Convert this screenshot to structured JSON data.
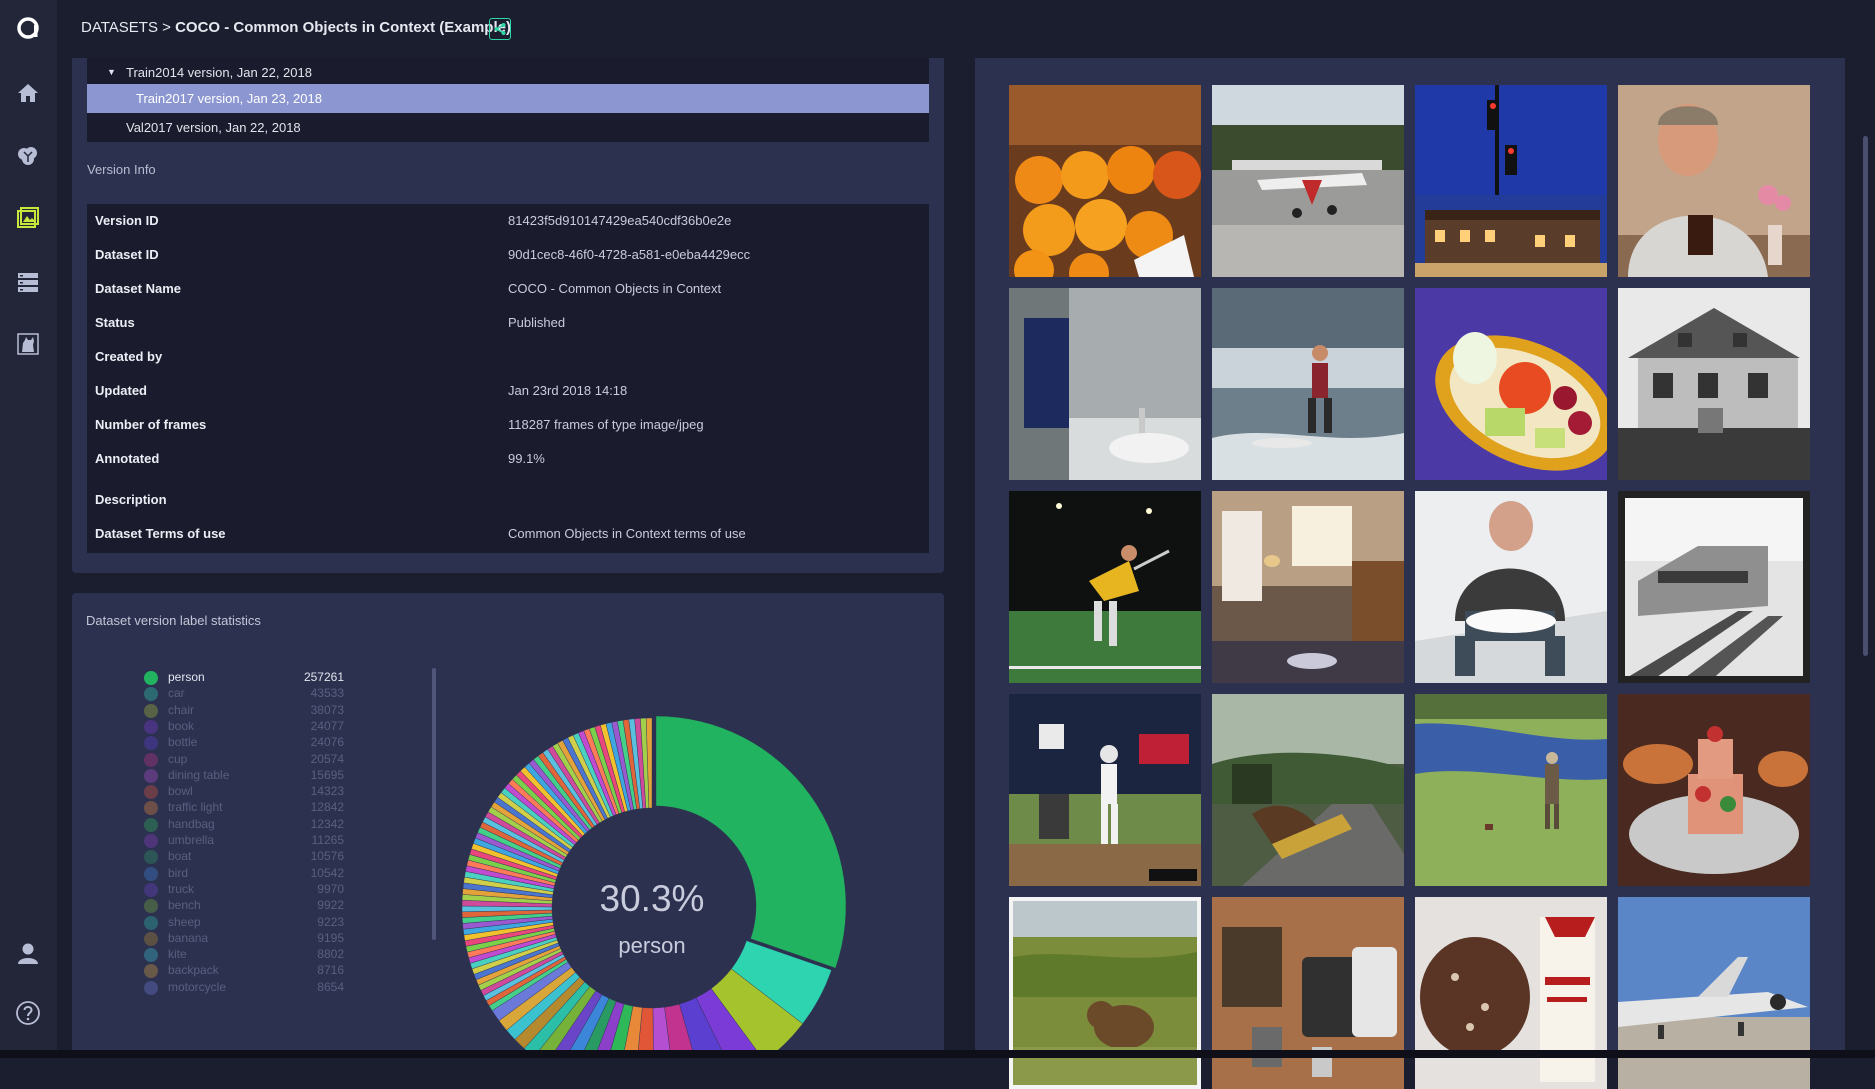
{
  "breadcrumb": {
    "section": "DATASETS",
    "separator": " > ",
    "title": "COCO - Common Objects in Context (Example)"
  },
  "sidebar": {
    "icons": [
      "logo-icon",
      "home-icon",
      "brain-icon",
      "image-icon",
      "database-icon",
      "cat-icon",
      "user-icon",
      "help-icon"
    ]
  },
  "versions": [
    {
      "label": "Train2014 version, Jan 22, 2018",
      "expanded": true
    },
    {
      "label": "Train2017 version, Jan 23, 2018",
      "selected": true
    },
    {
      "label": "Val2017 version, Jan 22, 2018"
    }
  ],
  "version_info_label": "Version Info",
  "info": [
    {
      "key": "Version ID",
      "value": "81423f5d910147429ea540cdf36b0e2e"
    },
    {
      "key": "Dataset ID",
      "value": "90d1cec8-46f0-4728-a581-e0eba4429ecc"
    },
    {
      "key": "Dataset Name",
      "value": "COCO - Common Objects in Context"
    },
    {
      "key": "Status",
      "value": "Published"
    },
    {
      "key": "Created by",
      "value": ""
    },
    {
      "key": "Updated",
      "value": "Jan 23rd 2018 14:18"
    },
    {
      "key": "Number of frames",
      "value": "118287 frames of type image/jpeg"
    },
    {
      "key": "Annotated",
      "value": "99.1%"
    },
    {
      "key": "Description",
      "value": ""
    },
    {
      "key": "Dataset Terms of use",
      "value": "Common Objects in Context terms of use"
    }
  ],
  "stats_title": "Dataset version label statistics",
  "donut_center": {
    "percent": "30.3%",
    "label": "person"
  },
  "labels": [
    {
      "name": "person",
      "count": "257261",
      "color": "#21b35f"
    },
    {
      "name": "car",
      "count": "43533",
      "color": "#2ed3b0"
    },
    {
      "name": "chair",
      "count": "38073",
      "color": "#a5c32d"
    },
    {
      "name": "book",
      "count": "24077",
      "color": "#7a3bd6"
    },
    {
      "name": "bottle",
      "count": "24076",
      "color": "#5b3fd0"
    },
    {
      "name": "cup",
      "count": "20574",
      "color": "#c2338f"
    },
    {
      "name": "dining table",
      "count": "15695",
      "color": "#b54fd1"
    },
    {
      "name": "bowl",
      "count": "14323",
      "color": "#e05636"
    },
    {
      "name": "traffic light",
      "count": "12842",
      "color": "#e8893a"
    },
    {
      "name": "handbag",
      "count": "12342",
      "color": "#2fb857"
    },
    {
      "name": "umbrella",
      "count": "11265",
      "color": "#8c3fc9"
    },
    {
      "name": "boat",
      "count": "10576",
      "color": "#2a9a63"
    },
    {
      "name": "bird",
      "count": "10542",
      "color": "#3b86d9"
    },
    {
      "name": "truck",
      "count": "9970",
      "color": "#6a45c8"
    },
    {
      "name": "bench",
      "count": "9922",
      "color": "#76b23a"
    },
    {
      "name": "sheep",
      "count": "9223",
      "color": "#2bbfa8"
    },
    {
      "name": "banana",
      "count": "9195",
      "color": "#b58a2f"
    },
    {
      "name": "kite",
      "count": "8802",
      "color": "#3cc2cf"
    },
    {
      "name": "backpack",
      "count": "8716",
      "color": "#d9a63a"
    },
    {
      "name": "motorcycle",
      "count": "8654",
      "color": "#6b7ad8"
    }
  ],
  "chart_data": {
    "type": "pie",
    "categories": [
      "person",
      "car",
      "chair",
      "book",
      "bottle",
      "cup",
      "dining table",
      "bowl",
      "traffic light",
      "handbag",
      "umbrella",
      "boat",
      "bird",
      "truck",
      "bench",
      "sheep",
      "banana",
      "kite",
      "backpack",
      "motorcycle"
    ],
    "values": [
      257261,
      43533,
      38073,
      24077,
      24076,
      20574,
      15695,
      14323,
      12842,
      12342,
      11265,
      10576,
      10542,
      9970,
      9922,
      9223,
      9195,
      8802,
      8716,
      8654
    ],
    "center_text": "30.3% person",
    "donut": true
  },
  "thumbnails": [
    "oranges",
    "airplane",
    "traffic-light",
    "man-at-table",
    "bathroom",
    "surfer",
    "bento",
    "farmhouse",
    "tennis",
    "kitchen",
    "toilet-man",
    "train",
    "baseball",
    "skateboard",
    "fisherman",
    "cake",
    "bear",
    "bag-contents",
    "chocolate-cake",
    "jet"
  ]
}
